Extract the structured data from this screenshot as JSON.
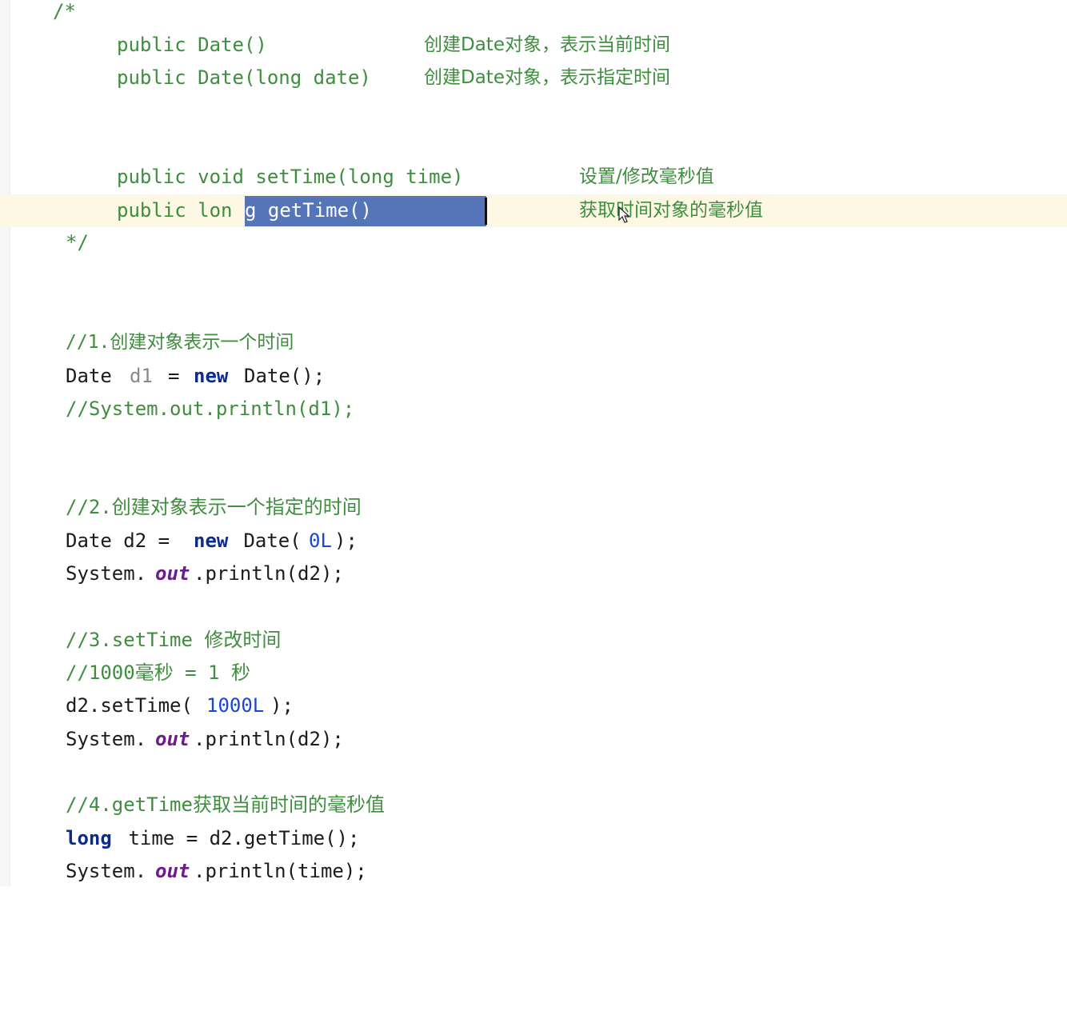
{
  "editor": {
    "doc_comment": {
      "open": "/*",
      "constructors": [
        {
          "signature": "public Date()",
          "desc": "创建Date对象，表示当前时间"
        },
        {
          "signature": "public Date(long date)",
          "desc": "创建Date对象，表示指定时间"
        }
      ],
      "set_time": {
        "signature": "public void setTime(long time)",
        "desc": "设置/修改毫秒值"
      },
      "get_time": {
        "prefix_plain": "public lon",
        "selected": "g getTime()",
        "desc": "获取时间对象的毫秒值"
      },
      "close": "*/"
    },
    "section1": {
      "comment": "//1.创建对象表示一个时间",
      "decl_type": "Date",
      "decl_var": "d1",
      "decl_eq": "=",
      "decl_new": "new",
      "decl_rest": "Date();",
      "commented_print": "//System.out.println(d1);"
    },
    "section2": {
      "comment": "//2.创建对象表示一个指定的时间",
      "decl_prefix": "Date d2 = ",
      "decl_new": "new",
      "decl_call": " Date(",
      "decl_arg": "0L",
      "decl_end": ");",
      "print_prefix": "System.",
      "print_field": "out",
      "print_suffix": ".println(d2);"
    },
    "section3": {
      "comment1": "//3.setTime 修改时间",
      "comment2": "//1000毫秒 = 1 秒",
      "call_prefix": "d2.setTime(",
      "call_arg": "1000L",
      "call_end": ");",
      "print_prefix": "System.",
      "print_field": "out",
      "print_suffix": ".println(d2);"
    },
    "section4": {
      "comment": "//4.getTime获取当前时间的毫秒值",
      "decl_type": "long",
      "decl_rest": " time = d2.getTime();",
      "print_prefix": "System.",
      "print_field": "out",
      "print_suffix": ".println(time);"
    }
  },
  "icons": {
    "mouse_cursor": "mouse-pointer-icon"
  },
  "colors": {
    "comment": "#3f8d3f",
    "keyword": "#0b2b8e",
    "number": "#1a46d6",
    "static_field": "#6b1d8b",
    "unused_var": "#8a8a8a",
    "selection": "#5575b8",
    "current_line": "#fcf8e4"
  }
}
